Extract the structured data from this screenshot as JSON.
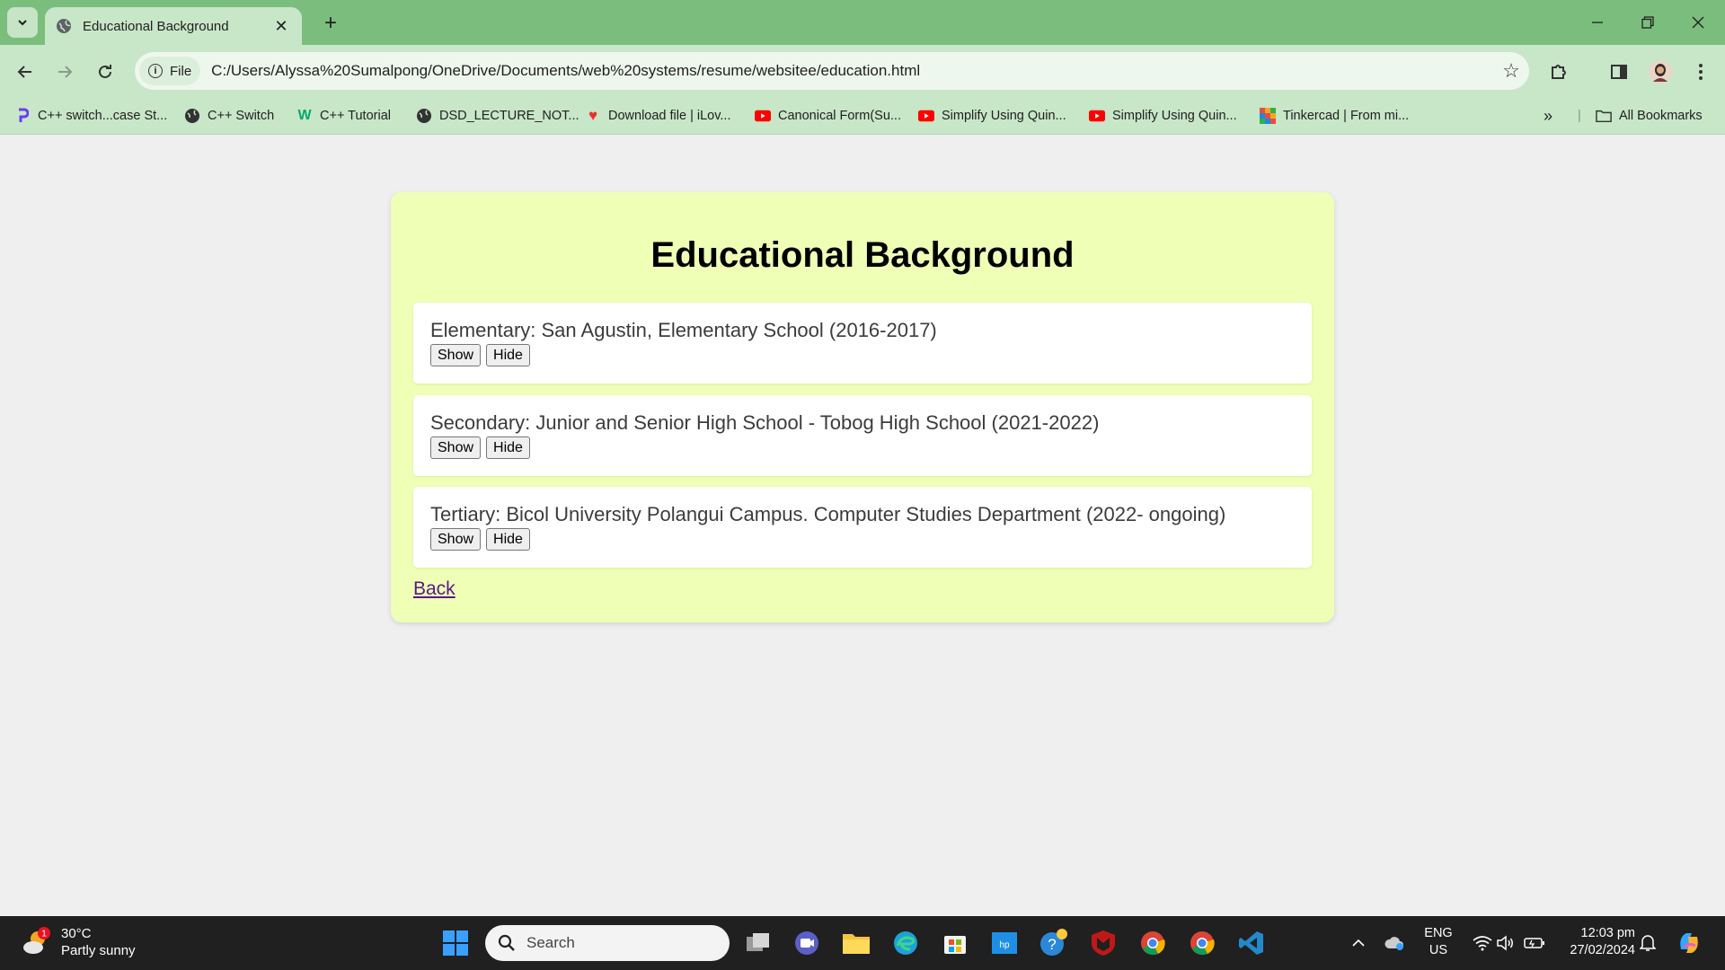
{
  "browser": {
    "tab_title": "Educational Background",
    "new_tab_label": "+",
    "site_chip_label": "File",
    "url": "C:/Users/Alyssa%20Sumalpong/OneDrive/Documents/web%20systems/resume/websitee/education.html",
    "bookmarks": [
      "C++ switch...case St...",
      "C++ Switch",
      "C++ Tutorial",
      "DSD_LECTURE_NOT...",
      "Download file | iLov...",
      "Canonical Form(Su...",
      "Simplify Using Quin...",
      "Simplify Using Quin...",
      "Tinkercad | From mi..."
    ],
    "all_bookmarks_label": "All Bookmarks"
  },
  "page": {
    "heading": "Educational Background",
    "entries": [
      {
        "text": "Elementary: San Agustin, Elementary School (2016-2017)",
        "show_label": "Show",
        "hide_label": "Hide"
      },
      {
        "text": "Secondary: Junior and Senior High School - Tobog High School (2021-2022)",
        "show_label": "Show",
        "hide_label": "Hide"
      },
      {
        "text": "Tertiary: Bicol University Polangui Campus. Computer Studies Department (2022- ongoing)",
        "show_label": "Show",
        "hide_label": "Hide"
      }
    ],
    "back_label": "Back"
  },
  "taskbar": {
    "weather_temp": "30°C",
    "weather_desc": "Partly sunny",
    "weather_badge": "1",
    "search_placeholder": "Search",
    "lang_line1": "ENG",
    "lang_line2": "US",
    "time": "12:03 pm",
    "date": "27/02/2024"
  },
  "colors": {
    "titlebar": "#7bbd7d",
    "toolbar": "#c8e6c8",
    "card": "#efffb6",
    "page_bg": "#efefef"
  }
}
